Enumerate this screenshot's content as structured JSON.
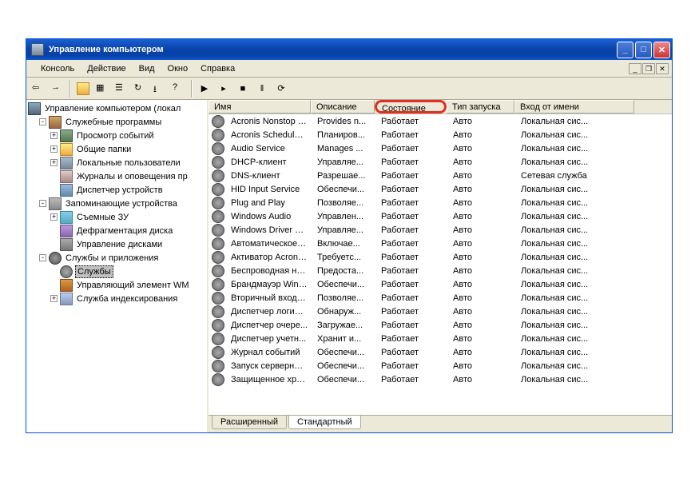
{
  "window": {
    "title": "Управление компьютером"
  },
  "menu": {
    "items": [
      "Консоль",
      "Действие",
      "Вид",
      "Окно",
      "Справка"
    ]
  },
  "tree": {
    "root": "Управление компьютером (локал",
    "groups": [
      {
        "label": "Служебные программы",
        "expanded": true,
        "children": [
          {
            "label": "Просмотр событий",
            "expandable": true
          },
          {
            "label": "Общие папки",
            "expandable": true
          },
          {
            "label": "Локальные пользователи",
            "expandable": true
          },
          {
            "label": "Журналы и оповещения пр",
            "expandable": false
          },
          {
            "label": "Диспетчер устройств",
            "expandable": false
          }
        ]
      },
      {
        "label": "Запоминающие устройства",
        "expanded": true,
        "children": [
          {
            "label": "Съемные ЗУ",
            "expandable": true
          },
          {
            "label": "Дефрагментация диска",
            "expandable": false
          },
          {
            "label": "Управление дисками",
            "expandable": false
          }
        ]
      },
      {
        "label": "Службы и приложения",
        "expanded": true,
        "children": [
          {
            "label": "Службы",
            "expandable": false,
            "selected": true
          },
          {
            "label": "Управляющий элемент WM",
            "expandable": false
          },
          {
            "label": "Служба индексирования",
            "expandable": true
          }
        ]
      }
    ]
  },
  "list": {
    "columns": {
      "name": "Имя",
      "description": "Описание",
      "state": "Состояние",
      "startup": "Тип запуска",
      "logon": "Вход от имени"
    },
    "rows": [
      {
        "name": "Acronis Nonstop Ba...",
        "desc": "Provides n...",
        "state": "Работает",
        "start": "Авто",
        "logon": "Локальная сис..."
      },
      {
        "name": "Acronis Scheduler2...",
        "desc": "Планиров...",
        "state": "Работает",
        "start": "Авто",
        "logon": "Локальная сис..."
      },
      {
        "name": "Audio Service",
        "desc": "Manages ...",
        "state": "Работает",
        "start": "Авто",
        "logon": "Локальная сис..."
      },
      {
        "name": "DHCP-клиент",
        "desc": "Управляе...",
        "state": "Работает",
        "start": "Авто",
        "logon": "Локальная сис..."
      },
      {
        "name": "DNS-клиент",
        "desc": "Разрешае...",
        "state": "Работает",
        "start": "Авто",
        "logon": "Сетевая служба"
      },
      {
        "name": "HID Input Service",
        "desc": "Обеспечи...",
        "state": "Работает",
        "start": "Авто",
        "logon": "Локальная сис..."
      },
      {
        "name": "Plug and Play",
        "desc": "Позволяе...",
        "state": "Работает",
        "start": "Авто",
        "logon": "Локальная сис..."
      },
      {
        "name": "Windows Audio",
        "desc": "Управлен...",
        "state": "Работает",
        "start": "Авто",
        "logon": "Локальная сис..."
      },
      {
        "name": "Windows Driver Fo...",
        "desc": "Управляе...",
        "state": "Работает",
        "start": "Авто",
        "logon": "Локальная сис..."
      },
      {
        "name": "Автоматическое о...",
        "desc": "Включае...",
        "state": "Работает",
        "start": "Авто",
        "logon": "Локальная сис..."
      },
      {
        "name": "Активатор Acronis...",
        "desc": "Требуетс...",
        "state": "Работает",
        "start": "Авто",
        "logon": "Локальная сис..."
      },
      {
        "name": "Беспроводная нас...",
        "desc": "Предоста...",
        "state": "Работает",
        "start": "Авто",
        "logon": "Локальная сис..."
      },
      {
        "name": "Брандмауэр Windo...",
        "desc": "Обеспечи...",
        "state": "Работает",
        "start": "Авто",
        "logon": "Локальная сис..."
      },
      {
        "name": "Вторичный вход в...",
        "desc": "Позволяе...",
        "state": "Работает",
        "start": "Авто",
        "logon": "Локальная сис..."
      },
      {
        "name": "Диспетчер логиче...",
        "desc": "Обнаруж...",
        "state": "Работает",
        "start": "Авто",
        "logon": "Локальная сис..."
      },
      {
        "name": "Диспетчер очере...",
        "desc": "Загружае...",
        "state": "Работает",
        "start": "Авто",
        "logon": "Локальная сис..."
      },
      {
        "name": "Диспетчер учетн...",
        "desc": "Хранит и...",
        "state": "Работает",
        "start": "Авто",
        "logon": "Локальная сис..."
      },
      {
        "name": "Журнал событий",
        "desc": "Обеспечи...",
        "state": "Работает",
        "start": "Авто",
        "logon": "Локальная сис..."
      },
      {
        "name": "Запуск серверных...",
        "desc": "Обеспечи...",
        "state": "Работает",
        "start": "Авто",
        "logon": "Локальная сис..."
      },
      {
        "name": "Защищенное хран...",
        "desc": "Обеспечи...",
        "state": "Работает",
        "start": "Авто",
        "logon": "Локальная сис..."
      }
    ]
  },
  "tabs": {
    "extended": "Расширенный",
    "standard": "Стандартный"
  }
}
